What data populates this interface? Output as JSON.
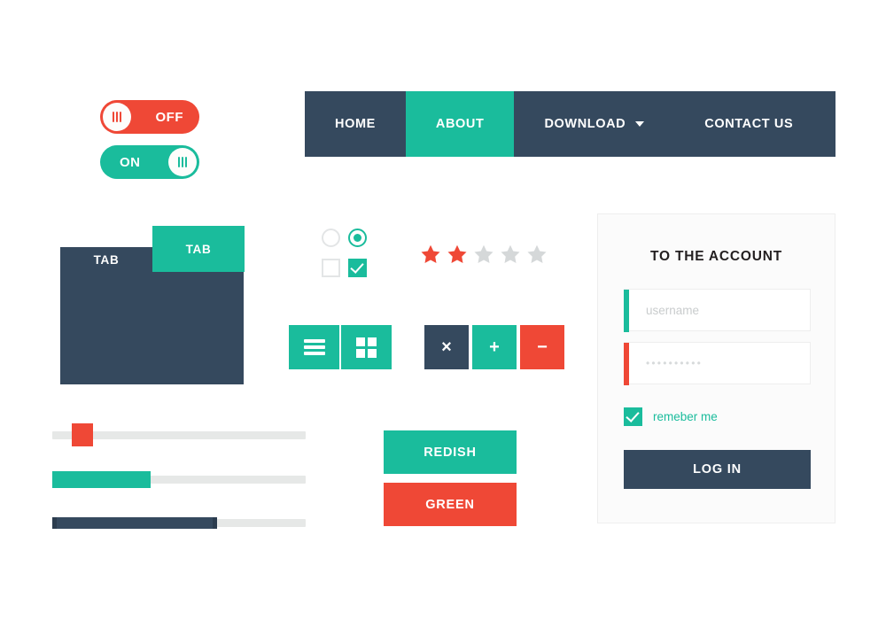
{
  "theme": {
    "green": "#1abc9c",
    "red": "#ef4836",
    "dark_navy": "#35495e",
    "track_gray": "#e6e8e7",
    "star_gray": "#d5d8d9",
    "panel_bg": "#fbfbfb",
    "placeholder_gray": "#c9cccd"
  },
  "toggles": [
    {
      "name": "off-toggle",
      "label": "OFF",
      "state": "off",
      "color": "#ef4836",
      "knob_side": "left"
    },
    {
      "name": "on-toggle",
      "label": "ON",
      "state": "on",
      "color": "#1abc9c",
      "knob_side": "right"
    }
  ],
  "navbar": {
    "items": [
      {
        "label": "HOME",
        "active": false,
        "has_dropdown": false
      },
      {
        "label": "ABOUT",
        "active": true,
        "has_dropdown": false
      },
      {
        "label": "DOWNLOAD",
        "active": false,
        "has_dropdown": true
      },
      {
        "label": "CONTACT US",
        "active": false,
        "has_dropdown": false
      }
    ]
  },
  "tabs": {
    "items": [
      {
        "label": "TAB",
        "active": false
      },
      {
        "label": "TAB",
        "active": true
      }
    ]
  },
  "selectors": {
    "radio_unchecked_name": "radio-unchecked",
    "radio_checked_name": "radio-checked",
    "checkbox_unchecked_name": "checkbox-unchecked",
    "checkbox_checked_name": "checkbox-checked"
  },
  "rating": {
    "total": 5,
    "filled": 2,
    "filled_color": "#ef4836",
    "empty_color": "#d5d8d9"
  },
  "view_buttons": [
    {
      "icon": "list-view-icon",
      "label": ""
    },
    {
      "icon": "grid-view-icon",
      "label": ""
    }
  ],
  "action_buttons": [
    {
      "icon": "close-icon",
      "label": "×",
      "color": "#35495e"
    },
    {
      "icon": "plus-icon",
      "label": "+",
      "color": "#1abc9c"
    },
    {
      "icon": "minus-icon",
      "label": "−",
      "color": "#ef4836"
    }
  ],
  "sliders": [
    {
      "name": "slider-red-handle",
      "value": 11,
      "style": "square-handle",
      "color": "#ef4836"
    },
    {
      "name": "slider-green-fill",
      "value": 39,
      "style": "fill-bar",
      "color": "#1abc9c"
    },
    {
      "name": "slider-dark-progress",
      "value": 65,
      "style": "progress",
      "color": "#35495e"
    }
  ],
  "color_buttons": [
    {
      "label": "REDISH",
      "color": "#1abc9c"
    },
    {
      "label": "GREEN",
      "color": "#ef4836"
    }
  ],
  "login": {
    "title": "TO THE ACCOUNT",
    "username": {
      "placeholder": "username",
      "value": "",
      "accent": "#1abc9c"
    },
    "password": {
      "placeholder": "",
      "value": "••••••••••",
      "accent": "#ef4836"
    },
    "remember": {
      "label": "remeber me",
      "checked": true
    },
    "submit_label": "LOG IN"
  }
}
